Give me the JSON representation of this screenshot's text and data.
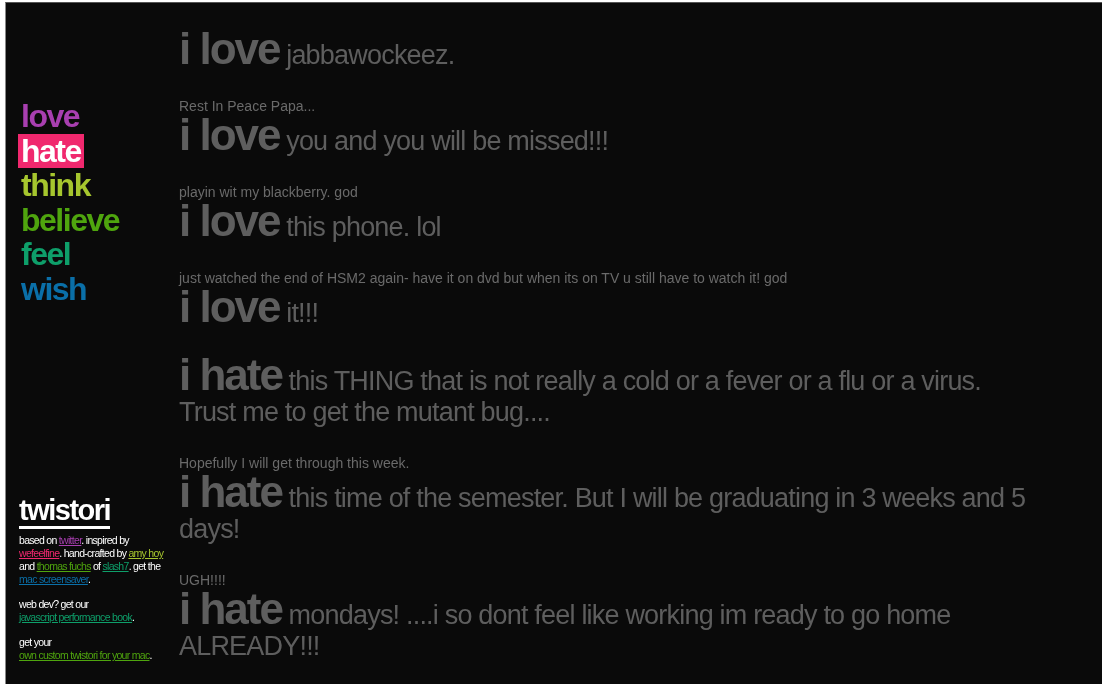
{
  "nav": [
    {
      "label": "love",
      "color": "#a83fb0",
      "selected": false
    },
    {
      "label": "hate",
      "color": "#f0286e",
      "selected": true
    },
    {
      "label": "think",
      "color": "#a6c62e",
      "selected": false
    },
    {
      "label": "believe",
      "color": "#4fa50e",
      "selected": false
    },
    {
      "label": "feel",
      "color": "#0e9f6a",
      "selected": false
    },
    {
      "label": "wish",
      "color": "#0a6fa8",
      "selected": false
    }
  ],
  "brand": "twistori",
  "footer": [
    [
      {
        "text": "based on "
      },
      {
        "link": "twitter",
        "color": "#a83fb0"
      },
      {
        "text": ". inspired by "
      },
      {
        "link": "wefeelfine",
        "color": "#f0286e"
      },
      {
        "text": ". hand-crafted by "
      },
      {
        "link": "amy hoy",
        "color": "#a6c62e"
      },
      {
        "text": " and "
      },
      {
        "link": "thomas fuchs",
        "color": "#4fa50e"
      },
      {
        "text": " of "
      },
      {
        "link": "slash7",
        "color": "#0e9f6a"
      },
      {
        "text": ". get the "
      },
      {
        "link": "mac screensaver",
        "color": "#0a6fa8"
      },
      {
        "text": "."
      }
    ],
    [
      {
        "text": "web dev? get our "
      },
      {
        "link": "javascript performance book",
        "color": "#0e9f6a"
      },
      {
        "text": "."
      }
    ],
    [
      {
        "text": "get your "
      },
      {
        "link": "own custom twistori for your mac",
        "color": "#4fa50e"
      },
      {
        "text": "."
      }
    ]
  ],
  "entries": [
    {
      "verb": "i love",
      "text": "jabbawockeez."
    },
    {
      "context": "Rest In Peace Papa...",
      "verb": "i love",
      "text": "you and you will be missed!!!"
    },
    {
      "context": "playin wit my blackberry. god",
      "verb": "i love",
      "text": "this phone. lol"
    },
    {
      "context": "just watched the end of HSM2 again- have it on dvd but when its on TV u still have to watch it! god",
      "verb": "i love",
      "text": "it!!!"
    },
    {
      "verb": "i hate",
      "text": "this THING that is not really a cold or a fever or a flu or a virus. Trust me to get the mutant bug...."
    },
    {
      "context": "Hopefully I will get through this week.",
      "verb": "i hate",
      "text": "this time of the semester. But I will be graduating in 3 weeks and 5 days!"
    },
    {
      "context": "UGH!!!!",
      "verb": "i hate",
      "text": "mondays! ....i so dont feel like working im ready to go home ALREADY!!!"
    }
  ]
}
